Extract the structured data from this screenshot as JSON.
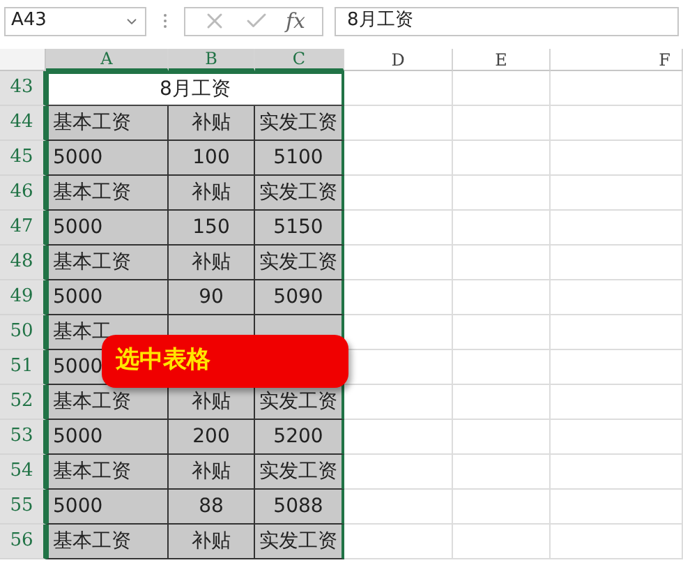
{
  "name_box": {
    "value": "A43"
  },
  "formula_buttons": {
    "function_label": "fx"
  },
  "formula_bar": {
    "value": "8月工资"
  },
  "columns": [
    {
      "label": "A",
      "selected": true
    },
    {
      "label": "B",
      "selected": true
    },
    {
      "label": "C",
      "selected": true
    },
    {
      "label": "D",
      "selected": false
    },
    {
      "label": "E",
      "selected": false
    },
    {
      "label": "F",
      "selected": false
    }
  ],
  "rows": [
    {
      "number": "43",
      "selected": true,
      "kind": "title",
      "cells": [
        {
          "text": "8月工资"
        }
      ]
    },
    {
      "number": "44",
      "selected": true,
      "kind": "data",
      "cells": [
        {
          "text": "基本工资"
        },
        {
          "text": "补贴"
        },
        {
          "text": "实发工资"
        }
      ]
    },
    {
      "number": "45",
      "selected": true,
      "kind": "data",
      "cells": [
        {
          "text": "5000"
        },
        {
          "text": "100"
        },
        {
          "text": "5100"
        }
      ]
    },
    {
      "number": "46",
      "selected": true,
      "kind": "data",
      "cells": [
        {
          "text": "基本工资"
        },
        {
          "text": "补贴"
        },
        {
          "text": "实发工资"
        }
      ]
    },
    {
      "number": "47",
      "selected": true,
      "kind": "data",
      "cells": [
        {
          "text": "5000"
        },
        {
          "text": "150"
        },
        {
          "text": "5150"
        }
      ]
    },
    {
      "number": "48",
      "selected": true,
      "kind": "data",
      "cells": [
        {
          "text": "基本工资"
        },
        {
          "text": "补贴"
        },
        {
          "text": "实发工资"
        }
      ]
    },
    {
      "number": "49",
      "selected": true,
      "kind": "data",
      "cells": [
        {
          "text": "5000"
        },
        {
          "text": "90"
        },
        {
          "text": "5090"
        }
      ]
    },
    {
      "number": "50",
      "selected": true,
      "kind": "data",
      "cells": [
        {
          "text": "基本工"
        },
        {},
        {}
      ]
    },
    {
      "number": "51",
      "selected": true,
      "kind": "data",
      "cells": [
        {
          "text": "5000"
        }
      ]
    },
    {
      "number": "52",
      "selected": true,
      "kind": "data",
      "cells": [
        {
          "text": "基本工资"
        },
        {
          "text": "补贴"
        },
        {
          "text": "实发工资"
        }
      ]
    },
    {
      "number": "53",
      "selected": true,
      "kind": "data",
      "cells": [
        {
          "text": "5000"
        },
        {
          "text": "200"
        },
        {
          "text": "5200"
        }
      ]
    },
    {
      "number": "54",
      "selected": true,
      "kind": "data",
      "cells": [
        {
          "text": "基本工资"
        },
        {
          "text": "补贴"
        },
        {
          "text": "实发工资"
        }
      ]
    },
    {
      "number": "55",
      "selected": true,
      "kind": "data",
      "cells": [
        {
          "text": "5000"
        },
        {
          "text": "88"
        },
        {
          "text": "5088"
        }
      ]
    },
    {
      "number": "56",
      "selected": true,
      "kind": "data",
      "cells": [
        {
          "text": "基本工资"
        },
        {
          "text": "补贴"
        },
        {
          "text": "实发工资"
        }
      ]
    }
  ],
  "callout": {
    "text": "选中表格"
  }
}
